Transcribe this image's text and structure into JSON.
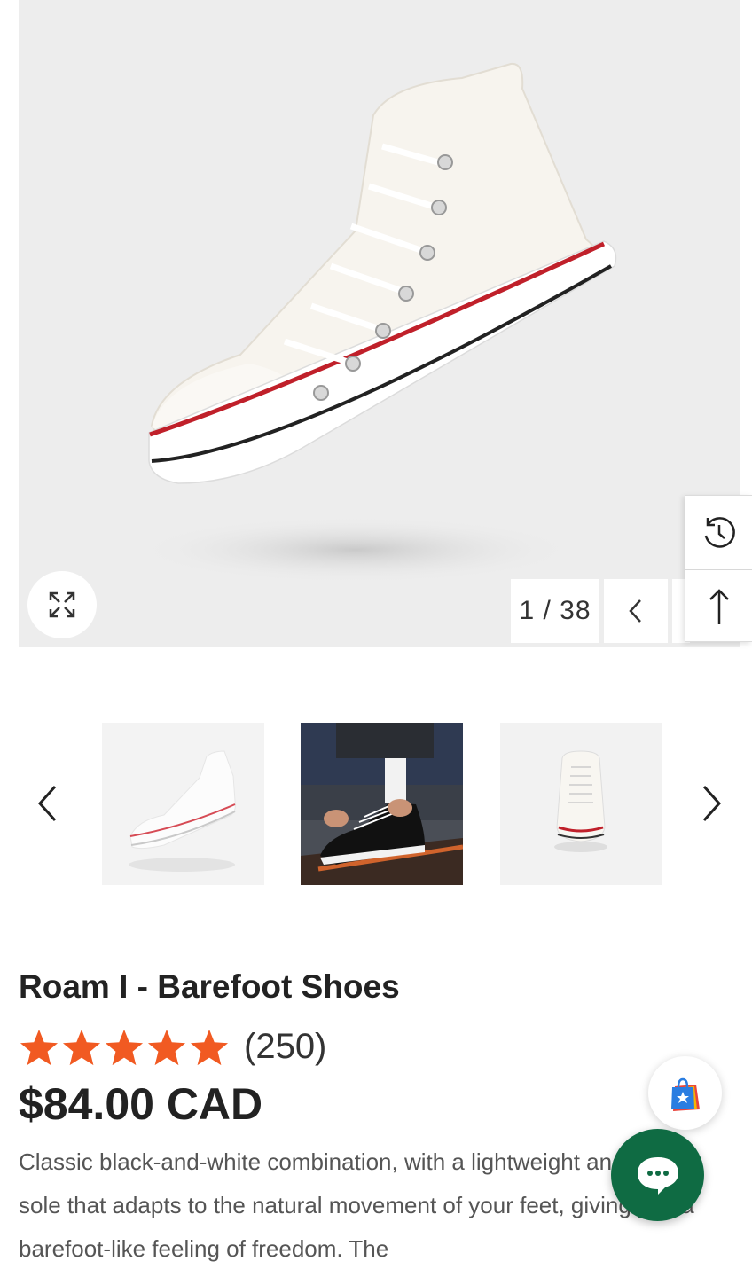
{
  "gallery": {
    "counter": "1 / 38",
    "main_image_alt": "White high-top canvas barefoot shoe"
  },
  "thumbnails": [
    {
      "alt": "White high-top shoe side view"
    },
    {
      "alt": "Person tying black high-top shoe on skateboard"
    },
    {
      "alt": "White high-top shoe front view"
    }
  ],
  "product": {
    "title": "Roam I - Barefoot Shoes",
    "rating": 5,
    "review_count": "(250)",
    "price": "$84.00 CAD",
    "description": "Classic black-and-white combination, with a lightweight and flexible sole that adapts to the natural movement of your feet, giving you a barefoot-like feeling of freedom. The"
  },
  "colors": {
    "star": "#f15a22",
    "chat": "#0f6b43",
    "hero_bg": "#ededed"
  },
  "icons": {
    "zoom": "expand-arrows-icon",
    "prev": "chevron-left-icon",
    "next": "chevron-right-icon",
    "history": "history-clock-icon",
    "top": "arrow-up-icon",
    "loyalty": "shopping-bag-star-icon",
    "chat": "chat-dots-icon"
  }
}
